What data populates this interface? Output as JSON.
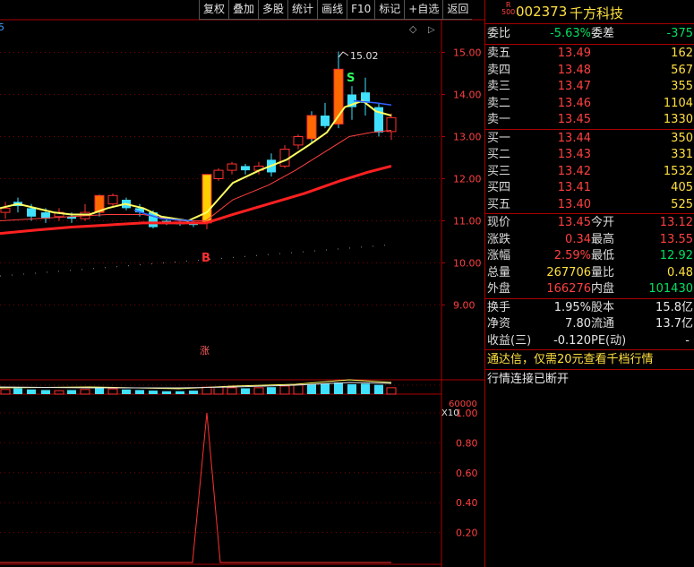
{
  "toolbar": {
    "items": [
      "复权",
      "叠加",
      "多股",
      "统计",
      "画线",
      "F10",
      "标记",
      "+自选",
      "返回"
    ]
  },
  "chart": {
    "price_axis": [
      "15.00",
      "14.00",
      "13.00",
      "12.00",
      "11.00",
      "10.00",
      "9.00"
    ],
    "vol_axis": [
      "60000"
    ],
    "vol_unit": "X10",
    "ind_axis": [
      "1.00",
      "0.80",
      "0.60",
      "0.40",
      "0.20"
    ],
    "high_label": "15.02",
    "buy_marker": "B",
    "sell_marker": "S",
    "limit_marker": "涨",
    "corner_marker": "5",
    "diamond": "◇",
    "arrow": "▷",
    "colors": {
      "up": "#ff3030",
      "down": "#40e0ff",
      "ma5": "#ffff60",
      "ma10": "#ff4040",
      "ma_long": "#ff2020"
    }
  },
  "stock": {
    "badge_top": "R",
    "badge_bottom": "500",
    "code": "002373",
    "name": "千方科技"
  },
  "quote": {
    "weibi_label": "委比",
    "weibi": "-5.63%",
    "weicha_label": "委差",
    "weicha": "-375",
    "asks": [
      {
        "label": "卖五",
        "price": "13.49",
        "vol": "162"
      },
      {
        "label": "卖四",
        "price": "13.48",
        "vol": "567"
      },
      {
        "label": "卖三",
        "price": "13.47",
        "vol": "355"
      },
      {
        "label": "卖二",
        "price": "13.46",
        "vol": "1104"
      },
      {
        "label": "卖一",
        "price": "13.45",
        "vol": "1330"
      }
    ],
    "bids": [
      {
        "label": "买一",
        "price": "13.44",
        "vol": "350"
      },
      {
        "label": "买二",
        "price": "13.43",
        "vol": "331"
      },
      {
        "label": "买三",
        "price": "13.42",
        "vol": "1532"
      },
      {
        "label": "买四",
        "price": "13.41",
        "vol": "405"
      },
      {
        "label": "买五",
        "price": "13.40",
        "vol": "525"
      }
    ],
    "stats1": [
      {
        "l1": "现价",
        "v1": "13.45",
        "c1": "red",
        "l2": "今开",
        "v2": "13.12",
        "c2": "red"
      },
      {
        "l1": "涨跌",
        "v1": "0.34",
        "c1": "red",
        "l2": "最高",
        "v2": "13.55",
        "c2": "red"
      },
      {
        "l1": "涨幅",
        "v1": "2.59%",
        "c1": "red",
        "l2": "最低",
        "v2": "12.92",
        "c2": "green"
      },
      {
        "l1": "总量",
        "v1": "267706",
        "c1": "yellow",
        "l2": "量比",
        "v2": "0.48",
        "c2": "yellow"
      },
      {
        "l1": "外盘",
        "v1": "166276",
        "c1": "red",
        "l2": "内盘",
        "v2": "101430",
        "c2": "green"
      }
    ],
    "stats2": [
      {
        "l1": "换手",
        "v1": "1.95%",
        "l2": "股本",
        "v2": "15.8亿"
      },
      {
        "l1": "净资",
        "v1": "7.80",
        "l2": "流通",
        "v2": "13.7亿"
      },
      {
        "l1": "收益(三)",
        "v1": "-0.120",
        "l2": "PE(动)",
        "v2": "-"
      }
    ],
    "promo": "通达信，仅需20元查看千档行情",
    "status": "行情连接已断开"
  }
}
